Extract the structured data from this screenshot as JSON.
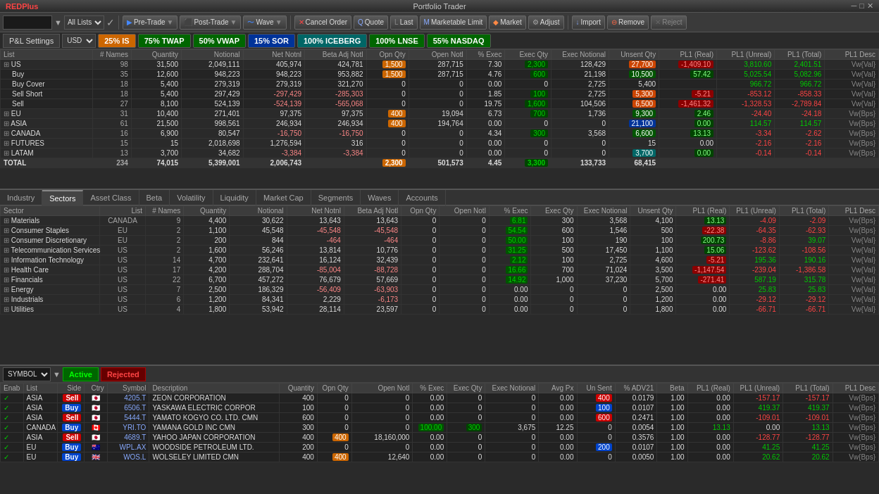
{
  "app": {
    "title": "Portfolio Trader",
    "window_title": "REDPlus"
  },
  "toolbar": {
    "search_placeholder": "",
    "all_lists": "All Lists",
    "pre_trade": "Pre-Trade",
    "post_trade": "Post-Trade",
    "wave": "Wave",
    "cancel_order": "Cancel Order",
    "quote": "Quote",
    "last": "Last",
    "marketable_limit": "Marketable Limit",
    "market": "Market",
    "adjust": "Adjust",
    "import": "Import",
    "remove": "Remove",
    "reject": "Reject"
  },
  "strategy_bar": {
    "pnl_settings": "P&L Settings",
    "currency": "USD",
    "is": "25% IS",
    "twap": "75% TWAP",
    "vwap": "50% VWAP",
    "sor": "15% SOR",
    "iceberg": "100% ICEBERG",
    "lnse": "100% LNSE",
    "nasdaq": "55% NASDAQ"
  },
  "upper_table": {
    "headers": [
      "List",
      "# Names",
      "Quantity",
      "Notional",
      "Net Notnl",
      "Beta Adj Notl",
      "Opn Qty",
      "Open Notl",
      "% Exec",
      "Exec Qty",
      "Exec Notional",
      "Unsent Qty",
      "PL1 (Real)",
      "PL1 (Unreal)",
      "PL1 (Total)",
      "PL1 Desc"
    ],
    "rows": [
      {
        "name": "US",
        "indent": 0,
        "expand": true,
        "names": 98,
        "qty": "31,500",
        "notional": "2,049,111",
        "net_notl": "405,974",
        "beta_adj": "424,781",
        "opn_qty": "1,500",
        "open_notl": "287,715",
        "pct_exec": "7.30",
        "exec_qty": "2,300",
        "exec_notl": "128,429",
        "unsent": "27,700",
        "pl_real": "-1,409.10",
        "pl_unreal": "3,810.60",
        "pl_total": "2,401.51",
        "pl_desc": "Vw{Val}",
        "pl_real_class": "red-bg"
      },
      {
        "name": "Buy",
        "indent": 1,
        "names": 35,
        "qty": "12,600",
        "notional": "948,223",
        "net_notl": "948,223",
        "beta_adj": "953,882",
        "opn_qty": "1,500",
        "open_notl": "287,715",
        "pct_exec": "4.76",
        "exec_qty": "600",
        "exec_notl": "21,198",
        "unsent": "10,500",
        "pl_real": "57.42",
        "pl_unreal": "5,025.54",
        "pl_total": "5,082.96",
        "pl_desc": "Vw{Val}",
        "pl_real_class": "green-bg"
      },
      {
        "name": "Buy Cover",
        "indent": 1,
        "names": 18,
        "qty": "5,400",
        "notional": "279,319",
        "net_notl": "279,319",
        "beta_adj": "321,270",
        "opn_qty": "0",
        "open_notl": "0",
        "pct_exec": "0.00",
        "exec_qty": "0",
        "exec_notl": "2,725",
        "unsent": "5,400",
        "pl_real": "",
        "pl_unreal": "966.72",
        "pl_total": "966.72",
        "pl_desc": "Vw{Val}",
        "pl_real_class": ""
      },
      {
        "name": "Sell Short",
        "indent": 1,
        "names": 18,
        "qty": "5,400",
        "notional": "297,429",
        "net_notl": "-297,429",
        "beta_adj": "-285,303",
        "opn_qty": "0",
        "open_notl": "0",
        "pct_exec": "1.85",
        "exec_qty": "100",
        "exec_notl": "2,725",
        "unsent": "5,300",
        "pl_real": "-5.21",
        "pl_unreal": "-853.12",
        "pl_total": "-858.33",
        "pl_desc": "Vw{Val}",
        "pl_real_class": "red-bg"
      },
      {
        "name": "Sell",
        "indent": 1,
        "names": 27,
        "qty": "8,100",
        "notional": "524,139",
        "net_notl": "-524,139",
        "beta_adj": "-565,068",
        "opn_qty": "0",
        "open_notl": "0",
        "pct_exec": "19.75",
        "exec_qty": "1,600",
        "exec_notl": "104,506",
        "unsent": "6,500",
        "pl_real": "-1,461.32",
        "pl_unreal": "-1,328.53",
        "pl_total": "-2,789.84",
        "pl_desc": "Vw{Val}",
        "pl_real_class": "red-bg"
      },
      {
        "name": "EU",
        "indent": 0,
        "expand": true,
        "names": 31,
        "qty": "10,400",
        "notional": "271,401",
        "net_notl": "97,375",
        "beta_adj": "97,375",
        "opn_qty": "400",
        "open_notl": "19,094",
        "pct_exec": "6.73",
        "exec_qty": "700",
        "exec_notl": "1,736",
        "unsent": "9,300",
        "pl_real": "2.46",
        "pl_unreal": "-24.40",
        "pl_total": "-24.18",
        "pl_desc": "Vw{Bps}",
        "pl_real_class": "green-bg"
      },
      {
        "name": "ASIA",
        "indent": 0,
        "expand": true,
        "names": 61,
        "qty": "21,500",
        "notional": "998,561",
        "net_notl": "246,934",
        "beta_adj": "246,934",
        "opn_qty": "400",
        "open_notl": "194,764",
        "pct_exec": "0.00",
        "exec_qty": "0",
        "exec_notl": "0",
        "unsent": "21,100",
        "pl_real": "0.00",
        "pl_unreal": "114.57",
        "pl_total": "114.57",
        "pl_desc": "Vw{Bps}",
        "pl_real_class": "blue-cell"
      },
      {
        "name": "CANADA",
        "indent": 0,
        "expand": true,
        "names": 16,
        "qty": "6,900",
        "notional": "80,547",
        "net_notl": "-16,750",
        "beta_adj": "-16,750",
        "opn_qty": "0",
        "open_notl": "0",
        "pct_exec": "4.34",
        "exec_qty": "300",
        "exec_notl": "3,568",
        "unsent": "6,600",
        "pl_real": "13.13",
        "pl_unreal": "-3.34",
        "pl_total": "-2.62",
        "pl_desc": "Vw{Bps}",
        "pl_real_class": "green-bg"
      },
      {
        "name": "FUTURES",
        "indent": 0,
        "expand": true,
        "names": 15,
        "qty": "15",
        "notional": "2,018,698",
        "net_notl": "1,276,594",
        "beta_adj": "316",
        "opn_qty": "0",
        "open_notl": "0",
        "pct_exec": "0.00",
        "exec_qty": "0",
        "exec_notl": "0",
        "unsent": "15",
        "pl_real": "0.00",
        "pl_unreal": "-2.16",
        "pl_total": "-2.16",
        "pl_desc": "Vw{Bps}",
        "pl_real_class": ""
      },
      {
        "name": "LATAM",
        "indent": 0,
        "expand": true,
        "names": 13,
        "qty": "3,700",
        "notional": "34,682",
        "net_notl": "-3,384",
        "beta_adj": "-3,384",
        "opn_qty": "0",
        "open_notl": "0",
        "pct_exec": "0.00",
        "exec_qty": "0",
        "exec_notl": "0",
        "unsent": "3,700",
        "pl_real": "0.00",
        "pl_unreal": "-0.14",
        "pl_total": "-0.14",
        "pl_desc": "Vw{Bps}",
        "pl_real_class": "teal-cell"
      },
      {
        "name": "TOTAL",
        "indent": 0,
        "names": 234,
        "qty": "74,015",
        "notional": "5,399,001",
        "net_notl": "2,006,743",
        "beta_adj": "",
        "opn_qty": "2,300",
        "open_notl": "501,573",
        "pct_exec": "4.45",
        "exec_qty": "3,300",
        "exec_notl": "133,733",
        "unsent": "68,415",
        "pl_real": "",
        "pl_unreal": "",
        "pl_total": "",
        "pl_desc": "",
        "pl_real_class": ""
      }
    ]
  },
  "tabs": [
    "Industry",
    "Sectors",
    "Asset Class",
    "Beta",
    "Volatility",
    "Liquidity",
    "Market Cap",
    "Segments",
    "Waves",
    "Accounts"
  ],
  "active_tab": "Sectors",
  "sectors_table": {
    "headers": [
      "Sector",
      "List",
      "# Names",
      "Quantity",
      "Notional",
      "Net Notnl",
      "Beta Adj Notl",
      "Opn Qty",
      "Open Notl",
      "% Exec",
      "Exec Qty",
      "Exec Notional",
      "Unsent Qty",
      "PL1 (Real)",
      "PL1 (Unreal)",
      "PL1 (Total)",
      "PL1 Desc"
    ],
    "rows": [
      {
        "sector": "Materials",
        "list": "CANADA",
        "names": 9,
        "qty": "4,400",
        "notional": "30,622",
        "net_notl": "13,643",
        "beta_adj": "13,643",
        "opn_qty": "0",
        "open_notl": "0",
        "pct_exec": "6.81",
        "exec_qty": "300",
        "exec_notl": "3,568",
        "unsent": "4,100",
        "pl_real": "13.13",
        "pl_unreal": "-4.09",
        "pl_total": "-2.09",
        "pl_desc": "Vw{Bps}",
        "pl_real_class": "green-bg"
      },
      {
        "sector": "Consumer Staples",
        "list": "EU",
        "names": 2,
        "qty": "1,100",
        "notional": "45,548",
        "net_notl": "-45,548",
        "beta_adj": "-45,548",
        "opn_qty": "0",
        "open_notl": "0",
        "pct_exec": "54.54",
        "exec_qty": "600",
        "exec_notl": "1,546",
        "unsent": "500",
        "pl_real": "-22.38",
        "pl_unreal": "-64.35",
        "pl_total": "-62.93",
        "pl_desc": "Vw{Bps}",
        "pl_real_class": "red-bg"
      },
      {
        "sector": "Consumer Discretionary",
        "list": "EU",
        "names": 2,
        "qty": "200",
        "notional": "844",
        "net_notl": "-464",
        "beta_adj": "-464",
        "opn_qty": "0",
        "open_notl": "0",
        "pct_exec": "50.00",
        "exec_qty": "100",
        "exec_notl": "190",
        "unsent": "100",
        "pl_real": "200.73",
        "pl_unreal": "-8.86",
        "pl_total": "39.07",
        "pl_desc": "Vw{Val}",
        "pl_real_class": "green-bg"
      },
      {
        "sector": "Telecommunication Services",
        "list": "US",
        "names": 2,
        "qty": "1,600",
        "notional": "56,246",
        "net_notl": "13,814",
        "beta_adj": "10,776",
        "opn_qty": "0",
        "open_notl": "0",
        "pct_exec": "31.25",
        "exec_qty": "500",
        "exec_notl": "17,450",
        "unsent": "1,100",
        "pl_real": "15.06",
        "pl_unreal": "-123.62",
        "pl_total": "-108.56",
        "pl_desc": "Vw{Val}",
        "pl_real_class": "green-bg"
      },
      {
        "sector": "Information Technology",
        "list": "US",
        "names": 14,
        "qty": "4,700",
        "notional": "232,641",
        "net_notl": "16,124",
        "beta_adj": "32,439",
        "opn_qty": "0",
        "open_notl": "0",
        "pct_exec": "2.12",
        "exec_qty": "100",
        "exec_notl": "2,725",
        "unsent": "4,600",
        "pl_real": "-5.21",
        "pl_unreal": "195.36",
        "pl_total": "190.16",
        "pl_desc": "Vw{Val}",
        "pl_real_class": "red-bg"
      },
      {
        "sector": "Health Care",
        "list": "US",
        "names": 17,
        "qty": "4,200",
        "notional": "288,704",
        "net_notl": "-85,004",
        "beta_adj": "-88,728",
        "opn_qty": "0",
        "open_notl": "0",
        "pct_exec": "16.66",
        "exec_qty": "700",
        "exec_notl": "71,024",
        "unsent": "3,500",
        "pl_real": "-1,147.54",
        "pl_unreal": "-239.04",
        "pl_total": "-1,386.58",
        "pl_desc": "Vw{Val}",
        "pl_real_class": "red-bg"
      },
      {
        "sector": "Financials",
        "list": "US",
        "names": 22,
        "qty": "6,700",
        "notional": "457,272",
        "net_notl": "76,679",
        "beta_adj": "57,669",
        "opn_qty": "0",
        "open_notl": "0",
        "pct_exec": "14.92",
        "exec_qty": "1,000",
        "exec_notl": "37,230",
        "unsent": "5,700",
        "pl_real": "-271.41",
        "pl_unreal": "587.19",
        "pl_total": "315.78",
        "pl_desc": "Vw{Val}",
        "pl_real_class": "red-bg"
      },
      {
        "sector": "Energy",
        "list": "US",
        "names": 7,
        "qty": "2,500",
        "notional": "186,329",
        "net_notl": "-56,409",
        "beta_adj": "-63,903",
        "opn_qty": "0",
        "open_notl": "0",
        "pct_exec": "0.00",
        "exec_qty": "0",
        "exec_notl": "0",
        "unsent": "2,500",
        "pl_real": "0.00",
        "pl_unreal": "25.83",
        "pl_total": "25.83",
        "pl_desc": "Vw{Val}",
        "pl_real_class": ""
      },
      {
        "sector": "Industrials",
        "list": "US",
        "names": 6,
        "qty": "1,200",
        "notional": "84,341",
        "net_notl": "2,229",
        "beta_adj": "-6,173",
        "opn_qty": "0",
        "open_notl": "0",
        "pct_exec": "0.00",
        "exec_qty": "0",
        "exec_notl": "0",
        "unsent": "1,200",
        "pl_real": "0.00",
        "pl_unreal": "-29.12",
        "pl_total": "-29.12",
        "pl_desc": "Vw{Val}",
        "pl_real_class": ""
      },
      {
        "sector": "Utilities",
        "list": "US",
        "names": 4,
        "qty": "1,800",
        "notional": "53,942",
        "net_notl": "28,114",
        "beta_adj": "23,597",
        "opn_qty": "0",
        "open_notl": "0",
        "pct_exec": "0.00",
        "exec_qty": "0",
        "exec_notl": "0",
        "unsent": "1,800",
        "pl_real": "0.00",
        "pl_unreal": "-66.71",
        "pl_total": "-66.71",
        "pl_desc": "Vw{Val}",
        "pl_real_class": ""
      }
    ]
  },
  "lower_section": {
    "symbol_label": "SYMBOL",
    "btn_active": "Active",
    "btn_rejected": "Rejected",
    "headers": [
      "Enab",
      "List",
      "Side",
      "Ctry",
      "Symbol",
      "Description",
      "Quantity",
      "Opn Qty",
      "Open Notl",
      "% Exec",
      "Exec Qty",
      "Exec Notional",
      "Avg Px",
      "Un Sent",
      "% ADV21",
      "Beta",
      "PL1 (Real)",
      "PL1 (Unreal)",
      "PL1 (Total)",
      "PL1 Desc"
    ],
    "orders": [
      {
        "enab": true,
        "list": "ASIA",
        "side": "Sell",
        "ctry": "JP",
        "symbol": "4205.T",
        "desc": "ZEON CORPORATION",
        "qty": "400",
        "opn_qty": "0",
        "open_notl": "0",
        "pct_exec": "0.00",
        "exec_qty": "0",
        "exec_notl": "0",
        "avg_px": "0.00",
        "unsent": "400",
        "pct_adv": "0.0179",
        "beta": "1.00",
        "pl_real": "0.00",
        "pl_unreal": "-157.17",
        "pl_total": "-157.17",
        "pl_desc": "Vw{Bps}"
      },
      {
        "enab": true,
        "list": "ASIA",
        "side": "Buy",
        "ctry": "JP",
        "symbol": "6506.T",
        "desc": "YASKAWA ELECTRIC CORPOR",
        "qty": "100",
        "opn_qty": "0",
        "open_notl": "0",
        "pct_exec": "0.00",
        "exec_qty": "0",
        "exec_notl": "0",
        "avg_px": "0.00",
        "unsent": "100",
        "pct_adv": "0.0107",
        "beta": "1.00",
        "pl_real": "0.00",
        "pl_unreal": "419.37",
        "pl_total": "419.37",
        "pl_desc": "Vw{Bps}"
      },
      {
        "enab": true,
        "list": "ASIA",
        "side": "Sell",
        "ctry": "JP",
        "symbol": "5444.T",
        "desc": "YAMATO KOGYO CO. LTD. CMN",
        "qty": "600",
        "opn_qty": "0",
        "open_notl": "0",
        "pct_exec": "0.00",
        "exec_qty": "0",
        "exec_notl": "0",
        "avg_px": "0.00",
        "unsent": "600",
        "pct_adv": "0.2471",
        "beta": "1.00",
        "pl_real": "0.00",
        "pl_unreal": "-109.01",
        "pl_total": "-109.01",
        "pl_desc": "Vw{Bps}"
      },
      {
        "enab": true,
        "list": "CANADA",
        "side": "Buy",
        "ctry": "CA",
        "symbol": "YRI.TO",
        "desc": "YAMANA GOLD INC CMN",
        "qty": "300",
        "opn_qty": "0",
        "open_notl": "0",
        "pct_exec": "100.00",
        "exec_qty": "300",
        "exec_notl": "3,675",
        "avg_px": "12.25",
        "unsent": "0",
        "pct_adv": "0.0054",
        "beta": "1.00",
        "pl_real": "13.13",
        "pl_unreal": "0.00",
        "pl_total": "13.13",
        "pl_desc": "Vw{Bps}"
      },
      {
        "enab": true,
        "list": "ASIA",
        "side": "Sell",
        "ctry": "JP",
        "symbol": "4689.T",
        "desc": "YAHOO JAPAN CORPORATION",
        "qty": "400",
        "opn_qty": "400",
        "open_notl": "18,160,000",
        "pct_exec": "0.00",
        "exec_qty": "0",
        "exec_notl": "0",
        "avg_px": "0.00",
        "unsent": "0",
        "pct_adv": "0.3576",
        "beta": "1.00",
        "pl_real": "0.00",
        "pl_unreal": "-128.77",
        "pl_total": "-128.77",
        "pl_desc": "Vw{Bps}"
      },
      {
        "enab": true,
        "list": "EU",
        "side": "Buy",
        "ctry": "AU",
        "symbol": "WPL.AX",
        "desc": "WOODSIDE PETROLEUM LTD.",
        "qty": "200",
        "opn_qty": "0",
        "open_notl": "0",
        "pct_exec": "0.00",
        "exec_qty": "0",
        "exec_notl": "0",
        "avg_px": "0.00",
        "unsent": "200",
        "pct_adv": "0.0107",
        "beta": "1.00",
        "pl_real": "0.00",
        "pl_unreal": "41.25",
        "pl_total": "41.25",
        "pl_desc": "Vw{Bps}"
      },
      {
        "enab": true,
        "list": "EU",
        "side": "Buy",
        "ctry": "GB",
        "symbol": "WOS.L",
        "desc": "WOLSELEY LIMITED CMN",
        "qty": "400",
        "opn_qty": "400",
        "open_notl": "12,640",
        "pct_exec": "0.00",
        "exec_qty": "0",
        "exec_notl": "0",
        "avg_px": "0.00",
        "unsent": "0",
        "pct_adv": "0.0050",
        "beta": "1.00",
        "pl_real": "0.00",
        "pl_unreal": "20.62",
        "pl_total": "20.62",
        "pl_desc": "Vw{Bps}"
      }
    ]
  }
}
